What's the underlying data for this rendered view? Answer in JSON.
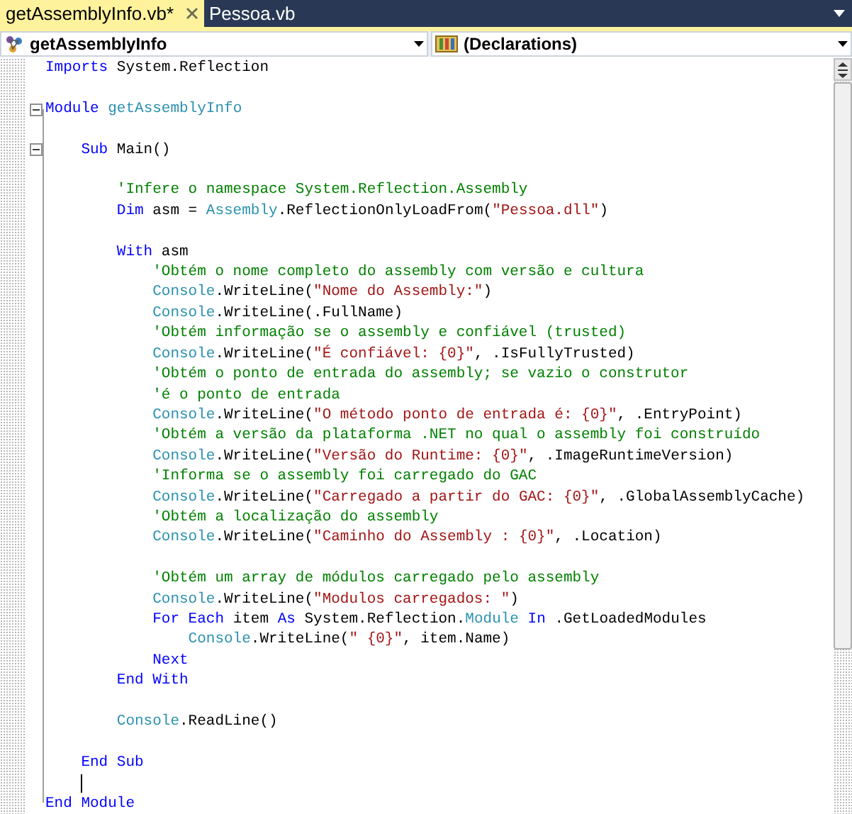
{
  "tabs": [
    {
      "label": "getAssemblyInfo.vb*",
      "selected": true
    },
    {
      "label": "Pessoa.vb",
      "selected": false
    }
  ],
  "navigation": {
    "type_dropdown": "getAssemblyInfo",
    "member_dropdown": "(Declarations)"
  },
  "code_lines": [
    {
      "kind": "code",
      "tokens": [
        {
          "kind": "keyword",
          "text": "Imports"
        },
        {
          "kind": "plain",
          "text": " System.Reflection"
        }
      ]
    },
    {
      "kind": "blank"
    },
    {
      "kind": "code",
      "fold": {
        "expanded": true
      },
      "tokens": [
        {
          "kind": "keyword",
          "text": "Module"
        },
        {
          "kind": "type",
          "text": " getAssemblyInfo"
        }
      ],
      "children": [
        {
          "kind": "blank"
        },
        {
          "kind": "code",
          "fold": {
            "expanded": true
          },
          "tokens": [
            {
              "kind": "keyword",
              "text": "Sub"
            },
            {
              "kind": "plain",
              "text": " Main()"
            }
          ],
          "children": [
            {
              "kind": "blank"
            },
            {
              "kind": "code",
              "tokens": [
                {
                  "kind": "comment",
                  "text": "'Infere o namespace System.Reflection.Assembly"
                }
              ]
            },
            {
              "kind": "code",
              "tokens": [
                {
                  "kind": "keyword",
                  "text": "Dim"
                },
                {
                  "kind": "plain",
                  "text": " asm = "
                },
                {
                  "kind": "type",
                  "text": "Assembly"
                },
                {
                  "kind": "plain",
                  "text": ".ReflectionOnlyLoadFrom("
                },
                {
                  "kind": "string",
                  "text": "\"Pessoa.dll\""
                },
                {
                  "kind": "plain",
                  "text": ")"
                }
              ]
            },
            {
              "kind": "blank"
            },
            {
              "kind": "code",
              "tokens": [
                {
                  "kind": "keyword",
                  "text": "With"
                },
                {
                  "kind": "plain",
                  "text": " asm"
                }
              ],
              "children": [
                {
                  "kind": "code",
                  "tokens": [
                    {
                      "kind": "comment",
                      "text": "'Obtém o nome completo do assembly com versão e cultura"
                    }
                  ]
                },
                {
                  "kind": "code",
                  "tokens": [
                    {
                      "kind": "type",
                      "text": "Console"
                    },
                    {
                      "kind": "plain",
                      "text": ".WriteLine("
                    },
                    {
                      "kind": "string",
                      "text": "\"Nome do Assembly:\""
                    },
                    {
                      "kind": "plain",
                      "text": ")"
                    }
                  ]
                },
                {
                  "kind": "code",
                  "tokens": [
                    {
                      "kind": "type",
                      "text": "Console"
                    },
                    {
                      "kind": "plain",
                      "text": ".WriteLine(.FullName)"
                    }
                  ]
                },
                {
                  "kind": "code",
                  "tokens": [
                    {
                      "kind": "comment",
                      "text": "'Obtém informação se o assembly e confiável (trusted)"
                    }
                  ]
                },
                {
                  "kind": "code",
                  "tokens": [
                    {
                      "kind": "type",
                      "text": "Console"
                    },
                    {
                      "kind": "plain",
                      "text": ".WriteLine("
                    },
                    {
                      "kind": "string",
                      "text": "\"É confiável: {0}\""
                    },
                    {
                      "kind": "plain",
                      "text": ", .IsFullyTrusted)"
                    }
                  ]
                },
                {
                  "kind": "code",
                  "tokens": [
                    {
                      "kind": "comment",
                      "text": "'Obtém o ponto de entrada do assembly; se vazio o construtor"
                    }
                  ]
                },
                {
                  "kind": "code",
                  "tokens": [
                    {
                      "kind": "comment",
                      "text": "'é o ponto de entrada"
                    }
                  ]
                },
                {
                  "kind": "code",
                  "tokens": [
                    {
                      "kind": "type",
                      "text": "Console"
                    },
                    {
                      "kind": "plain",
                      "text": ".WriteLine("
                    },
                    {
                      "kind": "string",
                      "text": "\"O método ponto de entrada é: {0}\""
                    },
                    {
                      "kind": "plain",
                      "text": ", .EntryPoint)"
                    }
                  ]
                },
                {
                  "kind": "code",
                  "tokens": [
                    {
                      "kind": "comment",
                      "text": "'Obtém a versão da plataforma .NET no qual o assembly foi construído"
                    }
                  ]
                },
                {
                  "kind": "code",
                  "tokens": [
                    {
                      "kind": "type",
                      "text": "Console"
                    },
                    {
                      "kind": "plain",
                      "text": ".WriteLine("
                    },
                    {
                      "kind": "string",
                      "text": "\"Versão do Runtime: {0}\""
                    },
                    {
                      "kind": "plain",
                      "text": ", .ImageRuntimeVersion)"
                    }
                  ]
                },
                {
                  "kind": "code",
                  "tokens": [
                    {
                      "kind": "comment",
                      "text": "'Informa se o assembly foi carregado do GAC"
                    }
                  ]
                },
                {
                  "kind": "code",
                  "tokens": [
                    {
                      "kind": "type",
                      "text": "Console"
                    },
                    {
                      "kind": "plain",
                      "text": ".WriteLine("
                    },
                    {
                      "kind": "string",
                      "text": "\"Carregado a partir do GAC: {0}\""
                    },
                    {
                      "kind": "plain",
                      "text": ", .GlobalAssemblyCache)"
                    }
                  ]
                },
                {
                  "kind": "code",
                  "tokens": [
                    {
                      "kind": "comment",
                      "text": "'Obtém a localização do assembly"
                    }
                  ]
                },
                {
                  "kind": "code",
                  "tokens": [
                    {
                      "kind": "type",
                      "text": "Console"
                    },
                    {
                      "kind": "plain",
                      "text": ".WriteLine("
                    },
                    {
                      "kind": "string",
                      "text": "\"Caminho do Assembly : {0}\""
                    },
                    {
                      "kind": "plain",
                      "text": ", .Location)"
                    }
                  ]
                },
                {
                  "kind": "blank"
                },
                {
                  "kind": "code",
                  "tokens": [
                    {
                      "kind": "comment",
                      "text": "'Obtém um array de módulos carregado pelo assembly"
                    }
                  ]
                },
                {
                  "kind": "code",
                  "tokens": [
                    {
                      "kind": "type",
                      "text": "Console"
                    },
                    {
                      "kind": "plain",
                      "text": ".WriteLine("
                    },
                    {
                      "kind": "string",
                      "text": "\"Modulos carregados: \""
                    },
                    {
                      "kind": "plain",
                      "text": ")"
                    }
                  ]
                },
                {
                  "kind": "code",
                  "tokens": [
                    {
                      "kind": "keyword",
                      "text": "For Each"
                    },
                    {
                      "kind": "plain",
                      "text": " item "
                    },
                    {
                      "kind": "keyword",
                      "text": "As"
                    },
                    {
                      "kind": "plain",
                      "text": " System.Reflection."
                    },
                    {
                      "kind": "type",
                      "text": "Module"
                    },
                    {
                      "kind": "keyword",
                      "text": " In"
                    },
                    {
                      "kind": "plain",
                      "text": " .GetLoadedModules"
                    }
                  ],
                  "children": [
                    {
                      "kind": "code",
                      "tokens": [
                        {
                          "kind": "type",
                          "text": "Console"
                        },
                        {
                          "kind": "plain",
                          "text": ".WriteLine("
                        },
                        {
                          "kind": "string",
                          "text": "\" {0}\""
                        },
                        {
                          "kind": "plain",
                          "text": ", item.Name)"
                        }
                      ]
                    }
                  ]
                },
                {
                  "kind": "code",
                  "tokens": [
                    {
                      "kind": "keyword",
                      "text": "Next"
                    }
                  ]
                }
              ]
            },
            {
              "kind": "code",
              "tokens": [
                {
                  "kind": "keyword",
                  "text": "End With"
                }
              ]
            },
            {
              "kind": "blank"
            },
            {
              "kind": "code",
              "tokens": [
                {
                  "kind": "type",
                  "text": "Console"
                },
                {
                  "kind": "plain",
                  "text": ".ReadLine()"
                }
              ]
            },
            {
              "kind": "blank"
            }
          ]
        },
        {
          "kind": "code",
          "tokens": [
            {
              "kind": "keyword",
              "text": "End Sub"
            }
          ]
        },
        {
          "kind": "caret"
        }
      ]
    },
    {
      "kind": "code",
      "tokens": [
        {
          "kind": "keyword",
          "text": "End Module"
        }
      ]
    }
  ]
}
